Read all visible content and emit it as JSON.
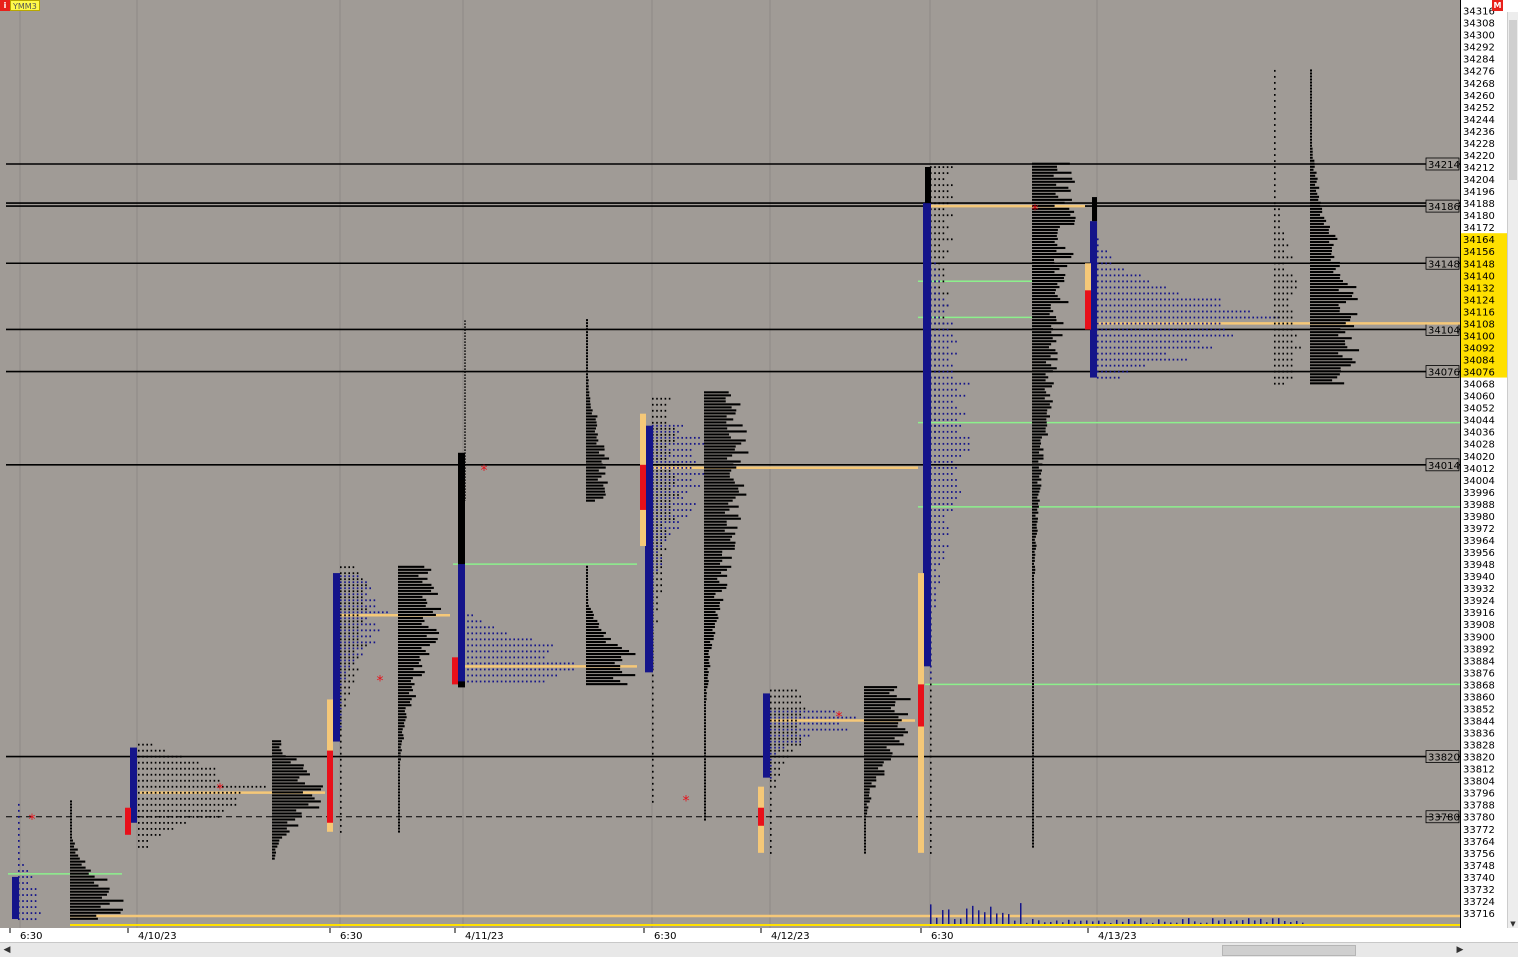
{
  "symbol": {
    "name": "YMM3",
    "icon": "i",
    "corner": "M"
  },
  "colors": {
    "background": "#a09b96",
    "tpo_blue": "#14148a",
    "tpo_black": "#000000",
    "value_green": "#8cf08c",
    "poc_orange": "#f5c878",
    "ib_red": "#e8101a",
    "highlight_yellow": "#ffe000",
    "star_red": "#e8101a"
  },
  "chart_data": {
    "type": "market-profile",
    "y_range": [
      33710,
      34318
    ],
    "tick_step": 8,
    "time_axis_labels": [
      "6:30",
      "4/10/23",
      "6:30",
      "4/11/23",
      "6:30",
      "4/12/23",
      "6:30",
      "4/13/23"
    ],
    "reference_levels": [
      34214,
      34188,
      34186,
      34148,
      34104,
      34076,
      34014,
      33820
    ],
    "dashed_levels": [
      33780
    ],
    "highlighted_price_band": [
      34076,
      34164
    ],
    "profiles": [
      {
        "session": "4/9 night",
        "color": "blue",
        "low": 33712,
        "high": 33790,
        "poc": 33722,
        "val": 33712,
        "vah": 33742
      },
      {
        "session": "4/10 night",
        "color": "blue",
        "low": 33760,
        "high": 33830,
        "poc": 33796,
        "val": 33786,
        "vah": 33824
      },
      {
        "session": "4/10 day",
        "color": "blue",
        "low": 33770,
        "high": 33946,
        "poc": 33914,
        "val": 33840,
        "vah": 33932
      },
      {
        "session": "4/11 night",
        "color": "blue",
        "low": 33890,
        "high": 34022,
        "poc": 33880,
        "val": 33872,
        "vah": 33948
      },
      {
        "session": "4/11 day",
        "color": "blue",
        "low": 33790,
        "high": 34060,
        "poc": 34012,
        "val": 33880,
        "vah": 34040
      },
      {
        "session": "4/12 night",
        "color": "blue",
        "low": 33756,
        "high": 33864,
        "poc": 33844,
        "val": 33806,
        "vah": 33852
      },
      {
        "session": "4/12 day",
        "color": "blue",
        "low": 33756,
        "high": 34214,
        "poc": 34186,
        "val": 33872,
        "vah": 34116
      },
      {
        "session": "4/13 night",
        "color": "blue",
        "low": 34072,
        "high": 34188,
        "poc": 34108,
        "val": 34080,
        "vah": 34148
      },
      {
        "session": "4/13 day",
        "color": "black",
        "low": 34068,
        "high": 34276,
        "poc": 34108,
        "val": 34084,
        "vah": 34140
      }
    ],
    "single_print_markers": [
      "*",
      "*",
      "*",
      "*",
      "*",
      "*",
      "*"
    ]
  }
}
